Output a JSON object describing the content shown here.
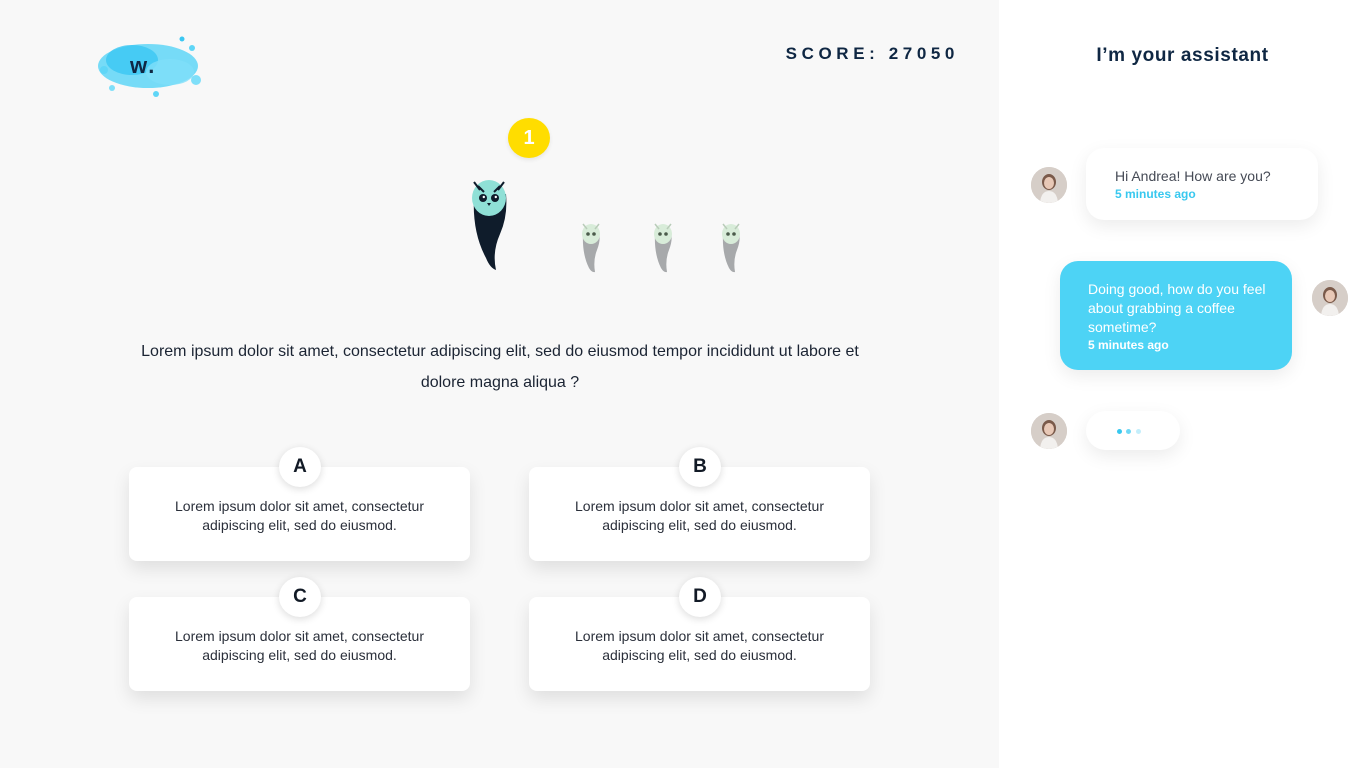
{
  "logo": {
    "text": "w."
  },
  "score": {
    "label": "SCORE:",
    "value": "27050"
  },
  "round_badge": "1",
  "question": "Lorem ipsum dolor sit amet, consectetur adipiscing elit, sed do eiusmod tempor incididunt ut labore et dolore magna aliqua ?",
  "answers": [
    {
      "letter": "A",
      "text": "Lorem ipsum dolor sit amet, consectetur adipiscing elit, sed do eiusmod."
    },
    {
      "letter": "B",
      "text": "Lorem ipsum dolor sit amet, consectetur adipiscing elit, sed do eiusmod."
    },
    {
      "letter": "C",
      "text": "Lorem ipsum dolor sit amet, consectetur adipiscing elit, sed do eiusmod."
    },
    {
      "letter": "D",
      "text": "Lorem ipsum dolor sit amet, consectetur adipiscing elit, sed do eiusmod."
    }
  ],
  "characters": {
    "active": "owl-ghost-character-icon",
    "others": [
      "small-ghost-icon",
      "small-ghost-icon",
      "small-ghost-icon"
    ]
  },
  "assistant": {
    "title": "I’m your assistant",
    "messages": [
      {
        "direction": "incoming",
        "text": "Hi Andrea! How are you?",
        "time": "5 minutes ago"
      },
      {
        "direction": "outgoing",
        "text": "Doing good, how do you feel about grabbing a coffee sometime?",
        "time": "5 minutes ago"
      }
    ],
    "typing_indicator": true
  },
  "colors": {
    "background": "#f8f8f8",
    "navy": "#0f2743",
    "accent_blue": "#4dd3f5",
    "badge_yellow": "#ffdd00",
    "panel": "#ffffff"
  }
}
